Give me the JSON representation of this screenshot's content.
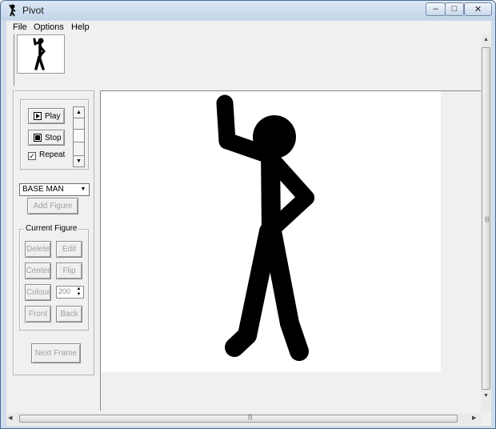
{
  "window": {
    "title": "Pivot",
    "minimize_glyph": "–",
    "maximize_glyph": "□",
    "close_glyph": "✕"
  },
  "menu": [
    "File",
    "Options",
    "Help"
  ],
  "playback": {
    "play_label": "Play",
    "stop_label": "Stop",
    "repeat_label": "Repeat",
    "repeat_checked": true,
    "check_glyph": "✓"
  },
  "figure_select": {
    "selected": "BASE MAN",
    "arrow": "▼"
  },
  "add_figure_label": "Add Figure",
  "current_figure": {
    "legend": "Current Figure",
    "delete_label": "Delete",
    "edit_label": "Edit",
    "center_label": "Center",
    "flip_label": "Flip",
    "colour_label": "Colour",
    "colour_value": "200",
    "front_label": "Front",
    "back_label": "Back"
  },
  "next_frame_label": "Next Frame",
  "scrollbars": {
    "up": "▲",
    "down": "▼",
    "left": "◀",
    "right": "▶",
    "grip": "|||"
  },
  "colors": {
    "figure": "#000000",
    "canvas": "#ffffff",
    "client": "#f0f0f0"
  }
}
